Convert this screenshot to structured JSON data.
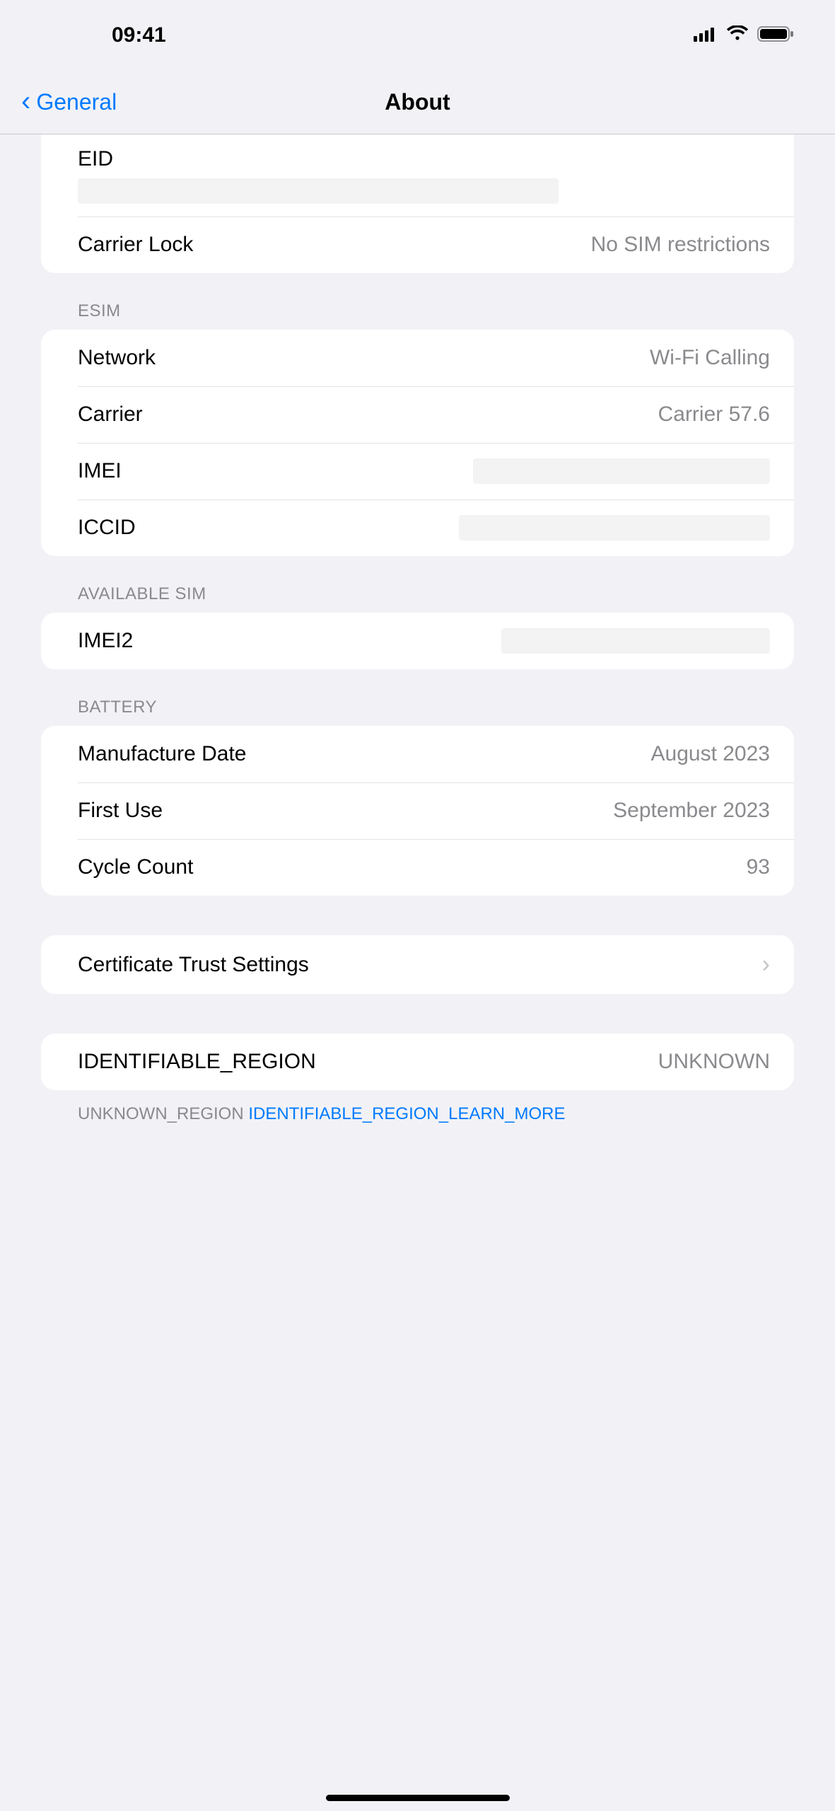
{
  "status": {
    "time": "09:41"
  },
  "nav": {
    "back": "General",
    "title": "About"
  },
  "group1": {
    "eid_label": "EID",
    "carrier_lock_label": "Carrier Lock",
    "carrier_lock_value": "No SIM restrictions"
  },
  "esim": {
    "header": "ESIM",
    "network_label": "Network",
    "network_value": "Wi-Fi Calling",
    "carrier_label": "Carrier",
    "carrier_value": "Carrier 57.6",
    "imei_label": "IMEI",
    "iccid_label": "ICCID"
  },
  "available_sim": {
    "header": "AVAILABLE SIM",
    "imei2_label": "IMEI2"
  },
  "battery": {
    "header": "BATTERY",
    "manufacture_label": "Manufacture Date",
    "manufacture_value": "August 2023",
    "first_use_label": "First Use",
    "first_use_value": "September 2023",
    "cycle_label": "Cycle Count",
    "cycle_value": "93"
  },
  "cert": {
    "label": "Certificate Trust Settings"
  },
  "region": {
    "label": "IDENTIFIABLE_REGION",
    "value": "UNKNOWN",
    "footer_prefix": "UNKNOWN_REGION ",
    "footer_link": "IDENTIFIABLE_REGION_LEARN_MORE"
  }
}
